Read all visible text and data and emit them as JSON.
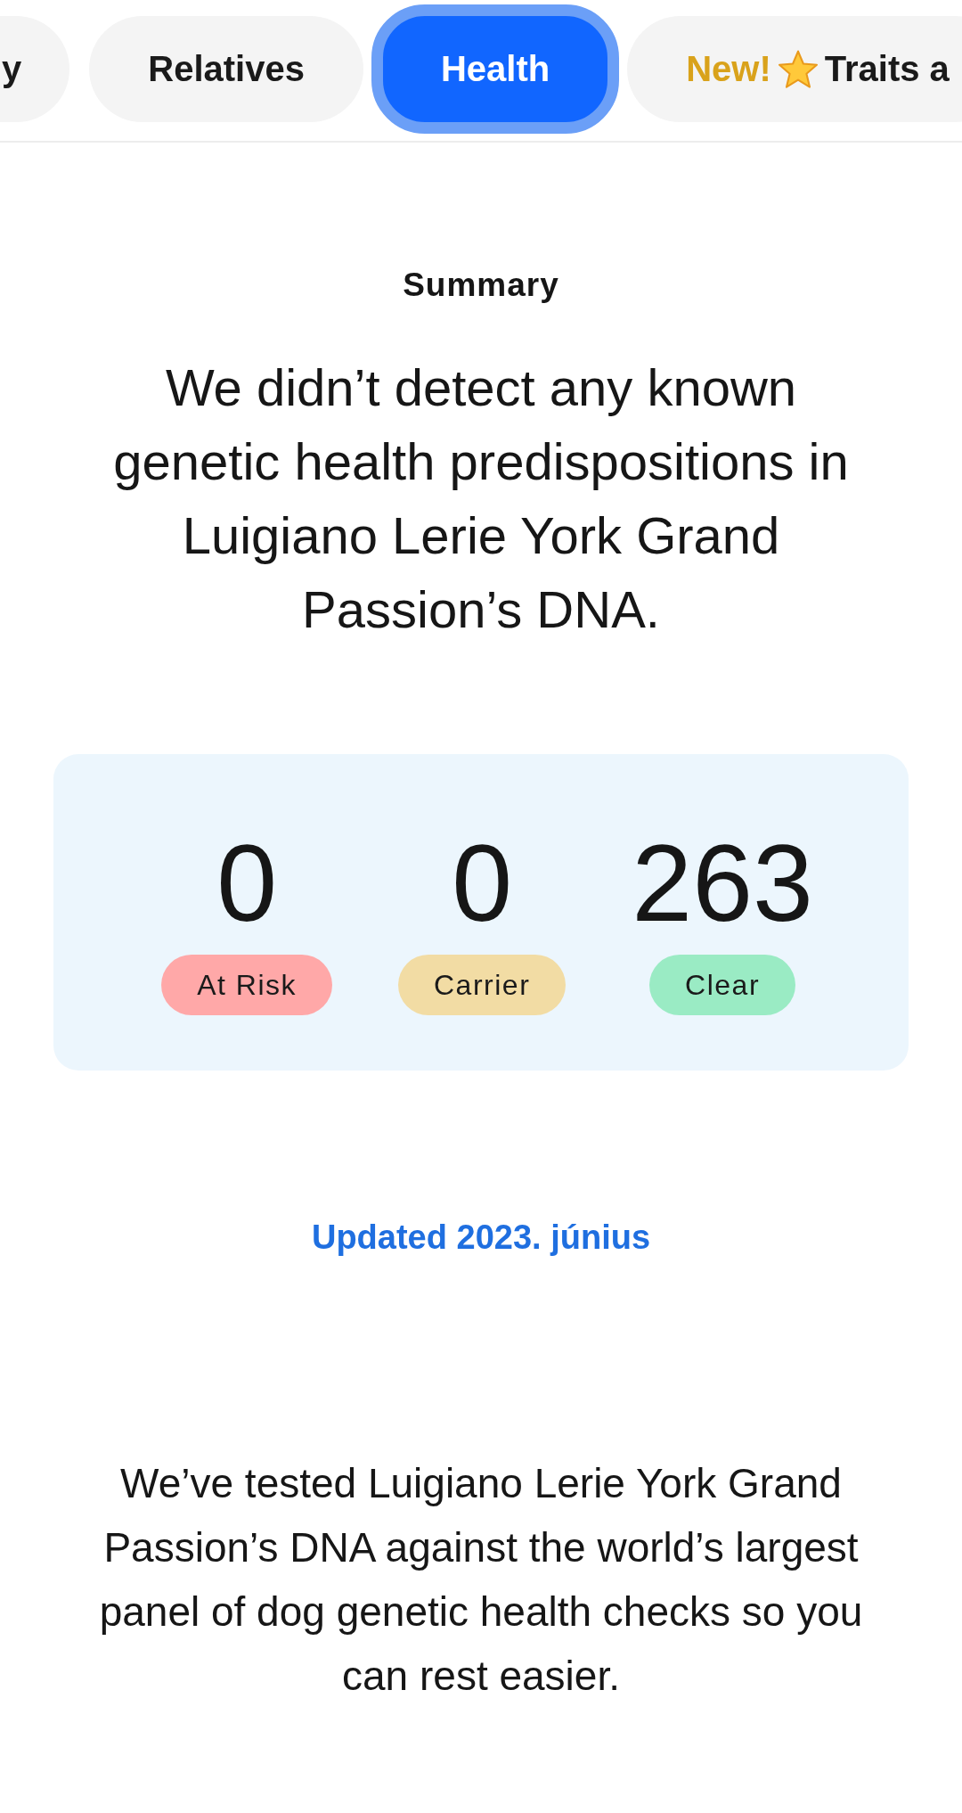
{
  "tabs": [
    {
      "label": "y",
      "selected": false
    },
    {
      "label": "Relatives",
      "selected": false
    },
    {
      "label": "Health",
      "selected": true
    },
    {
      "badge": "New!",
      "label": "Traits a",
      "selected": false
    }
  ],
  "summary": {
    "title": "Summary",
    "headline": "We didn’t detect any known genetic health predispositions in Luigiano Lerie York Grand Passion’s DNA."
  },
  "stats": [
    {
      "count": "0",
      "label": "At Risk",
      "color": "#ffa8a8"
    },
    {
      "count": "0",
      "label": "Carrier",
      "color": "#f2dca4"
    },
    {
      "count": "263",
      "label": "Clear",
      "color": "#9aebc4"
    }
  ],
  "updated_link": "Updated 2023. június",
  "description": "We’ve tested Luigiano Lerie York Grand Passion’s DNA against the world’s largest panel of dog genetic health checks so you can rest easier."
}
